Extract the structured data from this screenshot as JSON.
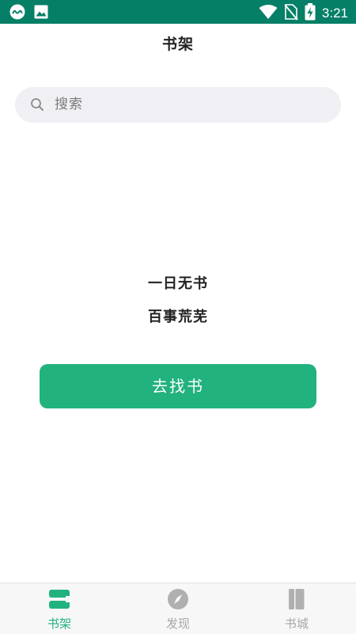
{
  "status_bar": {
    "time": "3:21",
    "icons": [
      "app-notification-icon",
      "image-notification-icon",
      "wifi-icon",
      "no-sim-icon",
      "battery-charging-icon"
    ]
  },
  "header": {
    "title": "书架"
  },
  "search": {
    "placeholder": "搜索"
  },
  "empty_state": {
    "line1": "一日无书",
    "line2": "百事荒芜",
    "button_label": "去找书"
  },
  "bottom_nav": {
    "tabs": [
      {
        "label": "书架",
        "icon": "bookshelf-icon",
        "active": true
      },
      {
        "label": "发现",
        "icon": "compass-icon",
        "active": false
      },
      {
        "label": "书城",
        "icon": "book-icon",
        "active": false
      }
    ]
  },
  "colors": {
    "status_bar": "#067f67",
    "accent": "#22b27d",
    "inactive": "#a7a7a7",
    "search_bg": "#f0f0f4"
  }
}
